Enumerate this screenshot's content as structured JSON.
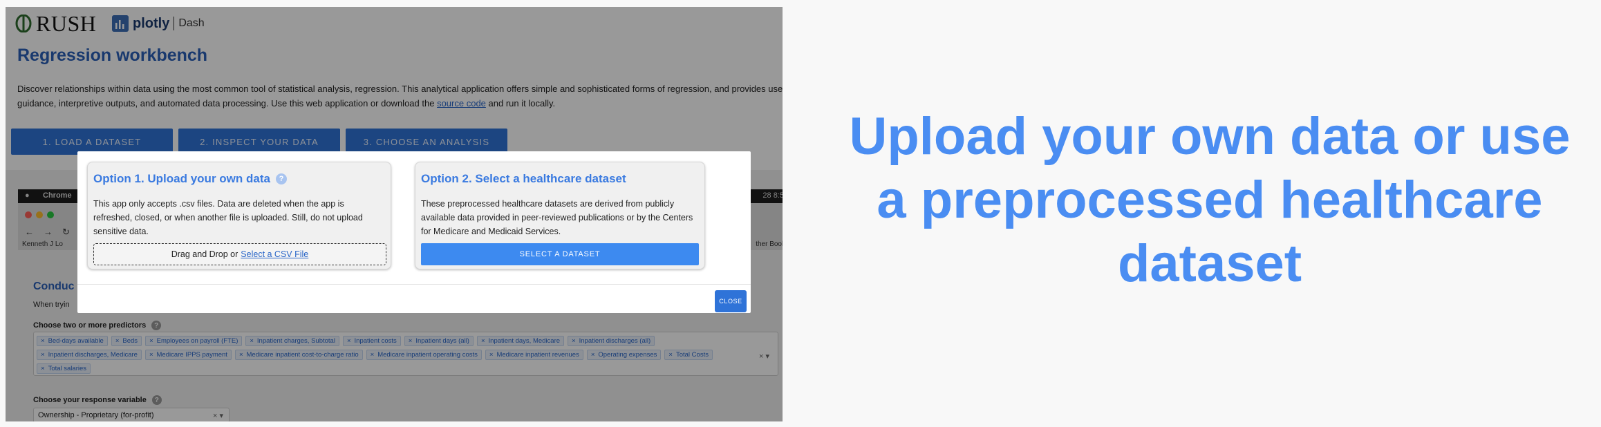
{
  "header": {
    "rush_logo_text": "RUSH",
    "plotly_logo_text": "plotly",
    "dash_logo_text": "Dash"
  },
  "page": {
    "title": "Regression workbench",
    "intro_before_link": "Discover relationships within data using the most common tool of statistical analysis, regression. This analytical application offers simple and sophisticated forms of regression, and provides useful guidance, interpretive outputs, and automated data processing. Use this web application or download the",
    "intro_link": "source code",
    "intro_after_link": "and run it locally."
  },
  "steps": [
    "1. LOAD A DATASET",
    "2. INSPECT YOUR DATA",
    "3. CHOOSE AN ANALYSIS"
  ],
  "background": {
    "mac_app": "Chrome",
    "clock_fragment": "28 8:5",
    "bookmark_left": "Kenneth J Lo",
    "bookmark_right": "ther Book",
    "section_title": "Conduc",
    "section_sub": "When tryin",
    "predictors_label": "Choose two or more predictors",
    "predictors": [
      "Bed-days available",
      "Beds",
      "Employees on payroll (FTE)",
      "Inpatient charges, Subtotal",
      "Inpatient costs",
      "Inpatient days (all)",
      "Inpatient days, Medicare",
      "Inpatient discharges (all)",
      "Inpatient discharges, Medicare",
      "Medicare IPPS payment",
      "Medicare inpatient cost-to-charge ratio",
      "Medicare inpatient operating costs",
      "Medicare inpatient revenues",
      "Operating expenses",
      "Total Costs",
      "Total salaries"
    ],
    "response_label": "Choose your response variable",
    "response_value": "Ownership - Proprietary (for-profit)"
  },
  "modal": {
    "option1": {
      "title": "Option 1. Upload your own data",
      "text": "This app only accepts .csv files. Data are deleted when the app is refreshed, closed, or when another file is uploaded. Still, do not upload sensitive data.",
      "drop_text": "Drag and Drop or",
      "drop_link": "Select a CSV File"
    },
    "option2": {
      "title": "Option 2. Select a healthcare dataset",
      "text": "These preprocessed healthcare datasets are derived from publicly available data provided in peer-reviewed publications or by the Centers for Medicare and Medicaid Services.",
      "button": "SELECT A DATASET"
    },
    "close": "CLOSE"
  },
  "headline": "Upload your own data or use a preprocessed healthcare dataset",
  "colors": {
    "accent": "#3d8af0",
    "title_blue": "#2b5fb8",
    "headline_blue": "#4a8df2",
    "step_button": "#2f73d8"
  }
}
